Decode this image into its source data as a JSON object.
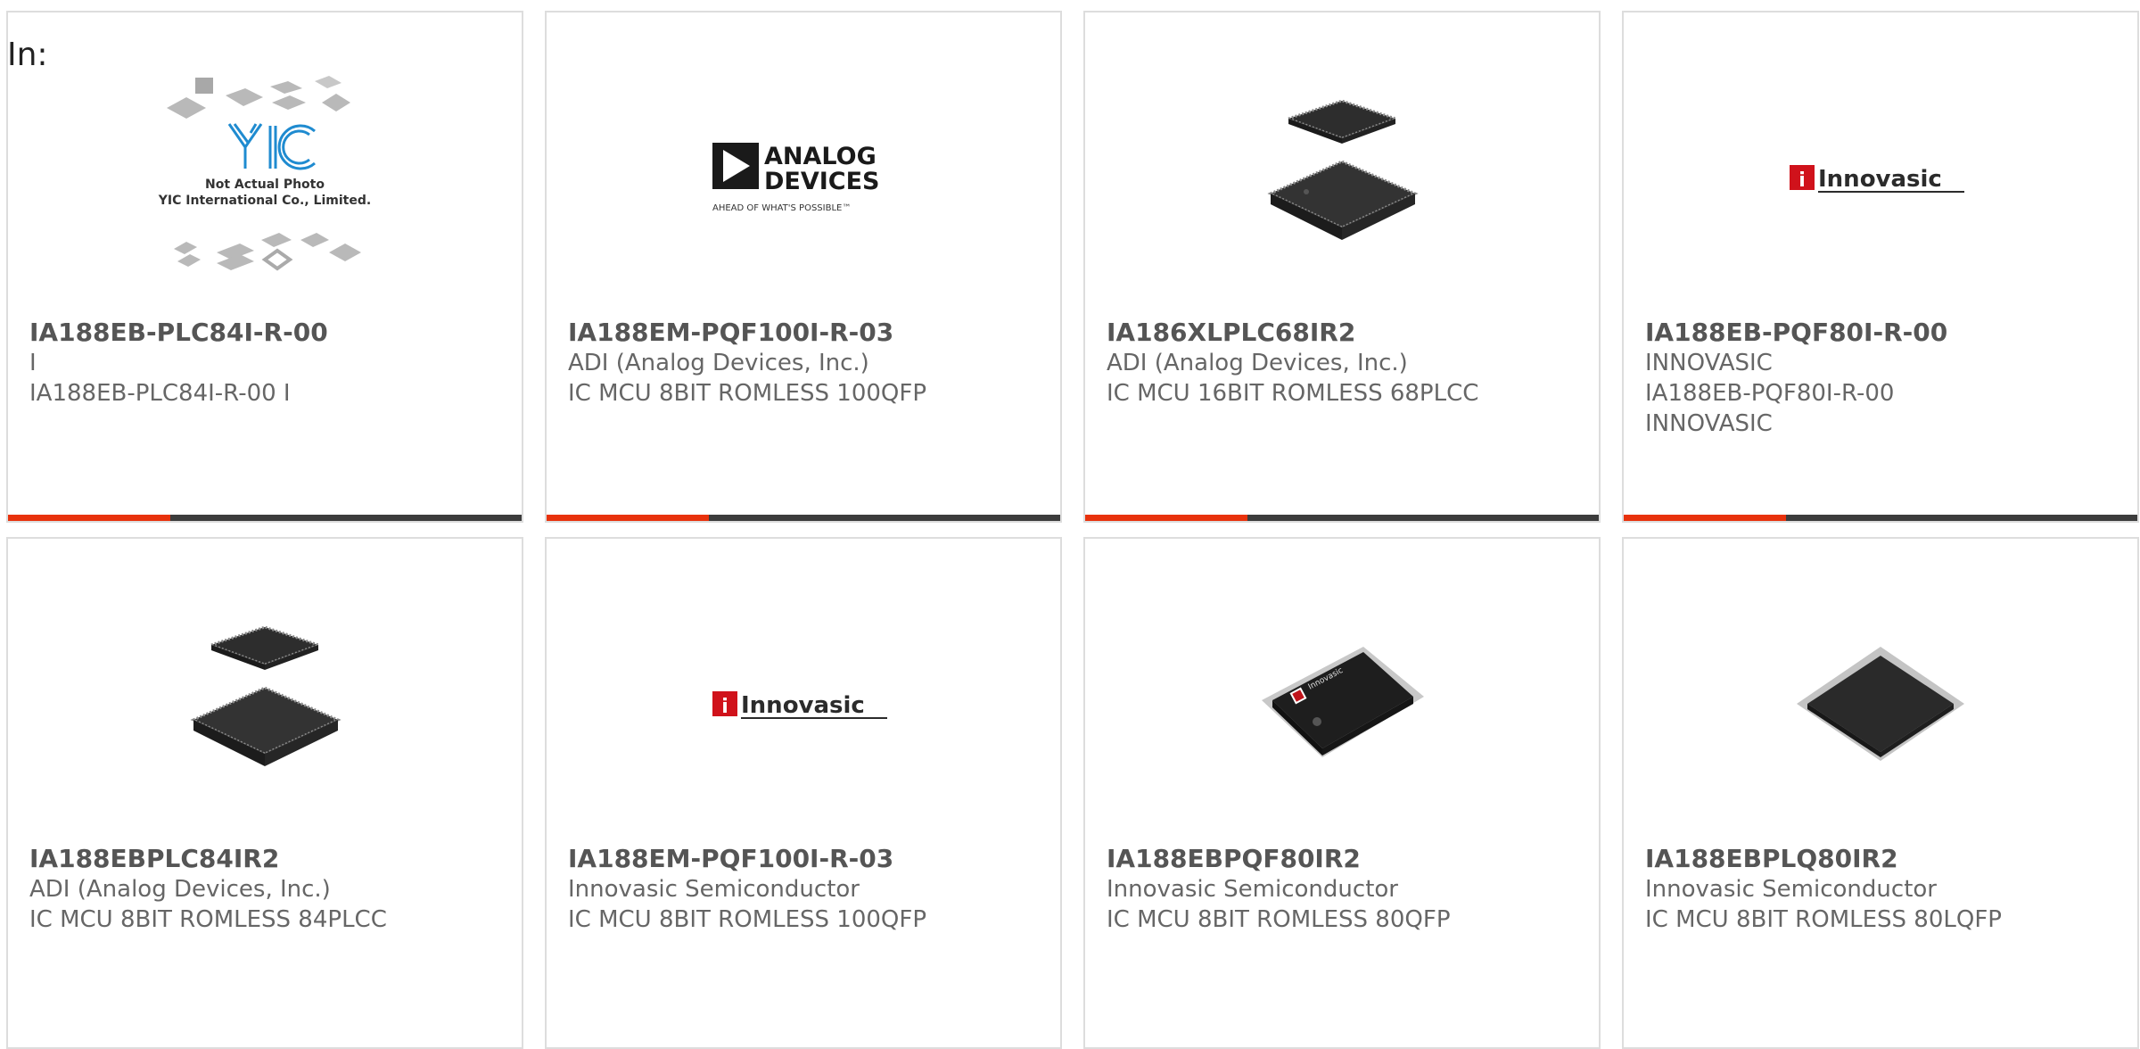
{
  "page": {
    "in_label": "In:"
  },
  "brand_logos": {
    "yic": {
      "mark": "YIC",
      "line1": "Not Actual Photo",
      "line2": "YIC International Co., Limited."
    },
    "analog_devices": {
      "line1": "ANALOG",
      "line2": "DEVICES",
      "tagline": "AHEAD OF WHAT'S POSSIBLE™"
    },
    "innovasic": {
      "wordmark": "Innovasic",
      "mark": "i"
    }
  },
  "colors": {
    "accent": "#e8320c",
    "bar": "#3c3c3c",
    "title": "#555555",
    "text": "#666666",
    "border": "#dddddd"
  },
  "products": [
    {
      "part": "IA188EB-PLC84I-R-00",
      "manufacturer": "I",
      "description": "IA188EB-PLC84I-R-00 I",
      "image": "not-actual-photo"
    },
    {
      "part": "IA188EM-PQF100I-R-03",
      "manufacturer": "ADI (Analog Devices, Inc.)",
      "description": "IC MCU 8BIT ROMLESS 100QFP",
      "image": "analog-devices-logo"
    },
    {
      "part": "IA186XLPLC68IR2",
      "manufacturer": "ADI (Analog Devices, Inc.)",
      "description": "IC MCU 16BIT ROMLESS 68PLCC",
      "image": "plcc-chip"
    },
    {
      "part": "IA188EB-PQF80I-R-00",
      "manufacturer": "INNOVASIC",
      "description": "IA188EB-PQF80I-R-00",
      "description2": "INNOVASIC",
      "image": "innovasic-logo"
    },
    {
      "part": "IA188EBPLC84IR2",
      "manufacturer": "ADI (Analog Devices, Inc.)",
      "description": "IC MCU 8BIT ROMLESS 84PLCC",
      "image": "plcc-chip"
    },
    {
      "part": "IA188EM-PQF100I-R-03",
      "manufacturer": "Innovasic Semiconductor",
      "description": "IC MCU 8BIT ROMLESS 100QFP",
      "image": "innovasic-logo"
    },
    {
      "part": "IA188EBPQF80IR2",
      "manufacturer": "Innovasic Semiconductor",
      "description": "IC MCU 8BIT ROMLESS 80QFP",
      "image": "qfp-chip"
    },
    {
      "part": "IA188EBPLQ80IR2",
      "manufacturer": "Innovasic Semiconductor",
      "description": "IC MCU 8BIT ROMLESS 80LQFP",
      "image": "lqfp-chip"
    }
  ]
}
